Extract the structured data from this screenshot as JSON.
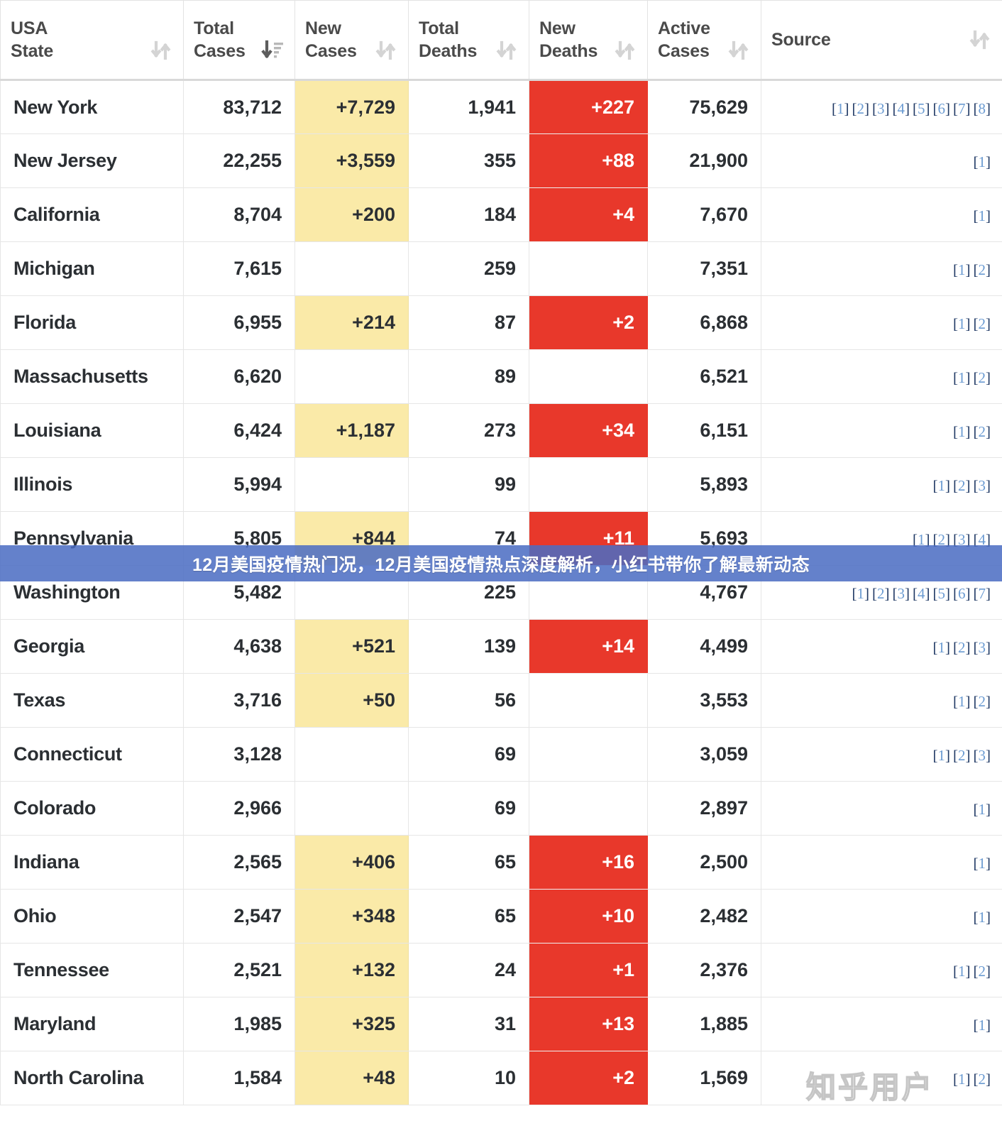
{
  "table": {
    "columns": [
      {
        "key": "state",
        "label": "USA\nState",
        "sort_icon": "sort-both-icon",
        "sorted": false
      },
      {
        "key": "tcases",
        "label": "Total\nCases",
        "sort_icon": "sort-desc-icon",
        "sorted": true
      },
      {
        "key": "ncases",
        "label": "New\nCases",
        "sort_icon": "sort-both-icon",
        "sorted": false
      },
      {
        "key": "tdeaths",
        "label": "Total\nDeaths",
        "sort_icon": "sort-both-icon",
        "sorted": false
      },
      {
        "key": "ndeaths",
        "label": "New\nDeaths",
        "sort_icon": "sort-both-icon",
        "sorted": false
      },
      {
        "key": "active",
        "label": "Active\nCases",
        "sort_icon": "sort-both-icon",
        "sorted": false
      },
      {
        "key": "source",
        "label": "Source",
        "sort_icon": "sort-both-icon",
        "sorted": false
      }
    ],
    "rows": [
      {
        "state": "New York",
        "total_cases": "83,712",
        "new_cases": "+7,729",
        "total_deaths": "1,941",
        "new_deaths": "+227",
        "active_cases": "75,629",
        "sources": [
          1,
          2,
          3,
          4,
          5,
          6,
          7,
          8
        ]
      },
      {
        "state": "New Jersey",
        "total_cases": "22,255",
        "new_cases": "+3,559",
        "total_deaths": "355",
        "new_deaths": "+88",
        "active_cases": "21,900",
        "sources": [
          1
        ]
      },
      {
        "state": "California",
        "total_cases": "8,704",
        "new_cases": "+200",
        "total_deaths": "184",
        "new_deaths": "+4",
        "active_cases": "7,670",
        "sources": [
          1
        ]
      },
      {
        "state": "Michigan",
        "total_cases": "7,615",
        "new_cases": "",
        "total_deaths": "259",
        "new_deaths": "",
        "active_cases": "7,351",
        "sources": [
          1,
          2
        ]
      },
      {
        "state": "Florida",
        "total_cases": "6,955",
        "new_cases": "+214",
        "total_deaths": "87",
        "new_deaths": "+2",
        "active_cases": "6,868",
        "sources": [
          1,
          2
        ]
      },
      {
        "state": "Massachusetts",
        "total_cases": "6,620",
        "new_cases": "",
        "total_deaths": "89",
        "new_deaths": "",
        "active_cases": "6,521",
        "sources": [
          1,
          2
        ]
      },
      {
        "state": "Louisiana",
        "total_cases": "6,424",
        "new_cases": "+1,187",
        "total_deaths": "273",
        "new_deaths": "+34",
        "active_cases": "6,151",
        "sources": [
          1,
          2
        ]
      },
      {
        "state": "Illinois",
        "total_cases": "5,994",
        "new_cases": "",
        "total_deaths": "99",
        "new_deaths": "",
        "active_cases": "5,893",
        "sources": [
          1,
          2,
          3
        ]
      },
      {
        "state": "Pennsylvania",
        "total_cases": "5,805",
        "new_cases": "+844",
        "total_deaths": "74",
        "new_deaths": "+11",
        "active_cases": "5,693",
        "sources": [
          1,
          2,
          3,
          4
        ]
      },
      {
        "state": "Washington",
        "total_cases": "5,482",
        "new_cases": "",
        "total_deaths": "225",
        "new_deaths": "",
        "active_cases": "4,767",
        "sources": [
          1,
          2,
          3,
          4,
          5,
          6,
          7
        ]
      },
      {
        "state": "Georgia",
        "total_cases": "4,638",
        "new_cases": "+521",
        "total_deaths": "139",
        "new_deaths": "+14",
        "active_cases": "4,499",
        "sources": [
          1,
          2,
          3
        ]
      },
      {
        "state": "Texas",
        "total_cases": "3,716",
        "new_cases": "+50",
        "total_deaths": "56",
        "new_deaths": "",
        "active_cases": "3,553",
        "sources": [
          1,
          2
        ]
      },
      {
        "state": "Connecticut",
        "total_cases": "3,128",
        "new_cases": "",
        "total_deaths": "69",
        "new_deaths": "",
        "active_cases": "3,059",
        "sources": [
          1,
          2,
          3
        ]
      },
      {
        "state": "Colorado",
        "total_cases": "2,966",
        "new_cases": "",
        "total_deaths": "69",
        "new_deaths": "",
        "active_cases": "2,897",
        "sources": [
          1
        ]
      },
      {
        "state": "Indiana",
        "total_cases": "2,565",
        "new_cases": "+406",
        "total_deaths": "65",
        "new_deaths": "+16",
        "active_cases": "2,500",
        "sources": [
          1
        ]
      },
      {
        "state": "Ohio",
        "total_cases": "2,547",
        "new_cases": "+348",
        "total_deaths": "65",
        "new_deaths": "+10",
        "active_cases": "2,482",
        "sources": [
          1
        ]
      },
      {
        "state": "Tennessee",
        "total_cases": "2,521",
        "new_cases": "+132",
        "total_deaths": "24",
        "new_deaths": "+1",
        "active_cases": "2,376",
        "sources": [
          1,
          2
        ]
      },
      {
        "state": "Maryland",
        "total_cases": "1,985",
        "new_cases": "+325",
        "total_deaths": "31",
        "new_deaths": "+13",
        "active_cases": "1,885",
        "sources": [
          1
        ]
      },
      {
        "state": "North Carolina",
        "total_cases": "1,584",
        "new_cases": "+48",
        "total_deaths": "10",
        "new_deaths": "+2",
        "active_cases": "1,569",
        "sources": [
          1,
          2
        ]
      }
    ]
  },
  "overlay": {
    "banner_text": "12月美国疫情热门况，12月美国疫情热点深度解析，小红书带你了解最新动态",
    "watermark_text": "知乎用户"
  },
  "colors": {
    "new_cases_highlight": "#faeaa8",
    "new_deaths_highlight": "#e8382b",
    "banner_background": "#4a6cc2",
    "source_link": "#6b9bd2",
    "header_text": "#4a4a4a"
  }
}
